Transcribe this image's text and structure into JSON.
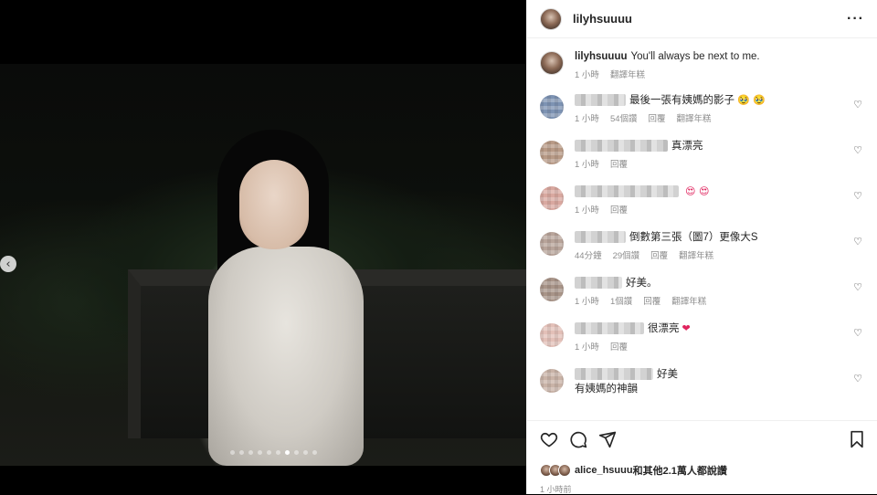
{
  "post": {
    "username": "lilyhsuuuu",
    "caption": "You'll always be next to me.",
    "caption_time": "1 小時",
    "caption_translate": "翻譯年糕",
    "carousel": {
      "total": 10,
      "active_index": 7
    }
  },
  "comments": [
    {
      "text": "最後一張有姨媽的影子",
      "emoji": "🥹 🥹",
      "emoji_color": "orange",
      "time": "1 小時",
      "likes": "54個讚",
      "reply": "回覆",
      "translate": "翻譯年糕",
      "name_w": 56
    },
    {
      "text": "真漂亮",
      "emoji": "",
      "emoji_color": "",
      "time": "1 小時",
      "likes": "",
      "reply": "回覆",
      "translate": "",
      "name_w": 102
    },
    {
      "text": "",
      "emoji": "😍 😍",
      "emoji_color": "red",
      "time": "1 小時",
      "likes": "",
      "reply": "回覆",
      "translate": "",
      "name_w": 114
    },
    {
      "text": "倒數第三張（圖7）更像大S",
      "emoji": "",
      "emoji_color": "",
      "time": "44分鐘",
      "likes": "29個讚",
      "reply": "回覆",
      "translate": "翻譯年糕",
      "name_w": 56
    },
    {
      "text": "好美。",
      "emoji": "",
      "emoji_color": "",
      "time": "1 小時",
      "likes": "1個讚",
      "reply": "回覆",
      "translate": "翻譯年糕",
      "name_w": 52
    },
    {
      "text": "很漂亮",
      "emoji": "❤",
      "emoji_color": "red",
      "time": "1 小時",
      "likes": "",
      "reply": "回覆",
      "translate": "",
      "name_w": 76
    },
    {
      "text": "好美",
      "text2": "有姨媽的神韻",
      "emoji": "",
      "emoji_color": "",
      "time": "",
      "likes": "",
      "reply": "",
      "translate": "",
      "name_w": 86
    }
  ],
  "footer": {
    "liked_by_user": "alice_hsuuu",
    "liked_by_rest": "和其他2.1萬人都說讚",
    "time_ago": "1 小時前"
  }
}
